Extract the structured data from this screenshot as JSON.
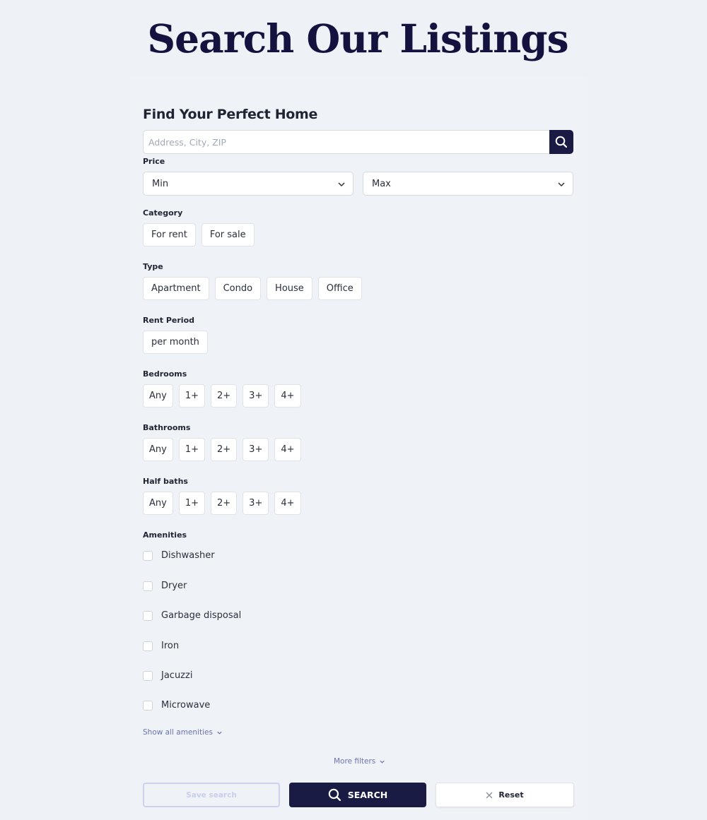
{
  "page": {
    "title": "Search Our Listings"
  },
  "form": {
    "title": "Find Your Perfect Home",
    "search": {
      "placeholder": "Address, City, ZIP",
      "value": ""
    },
    "price": {
      "label": "Price",
      "min": "Min",
      "max": "Max"
    },
    "category": {
      "label": "Category",
      "options": [
        "For rent",
        "For sale"
      ]
    },
    "type": {
      "label": "Type",
      "options": [
        "Apartment",
        "Condo",
        "House",
        "Office"
      ]
    },
    "rent_period": {
      "label": "Rent Period",
      "options": [
        "per month"
      ]
    },
    "bedrooms": {
      "label": "Bedrooms",
      "options": [
        "Any",
        "1+",
        "2+",
        "3+",
        "4+"
      ]
    },
    "bathrooms": {
      "label": "Bathrooms",
      "options": [
        "Any",
        "1+",
        "2+",
        "3+",
        "4+"
      ]
    },
    "half_baths": {
      "label": "Half baths",
      "options": [
        "Any",
        "1+",
        "2+",
        "3+",
        "4+"
      ]
    },
    "amenities": {
      "label": "Amenities",
      "items": [
        "Dishwasher",
        "Dryer",
        "Garbage disposal",
        "Iron",
        "Jacuzzi",
        "Microwave"
      ],
      "show_all": "Show all amenities"
    },
    "more_filters": "More filters",
    "buttons": {
      "save": "Save search",
      "search": "SEARCH",
      "reset": "Reset"
    }
  },
  "colors": {
    "accent": "#1a1b45",
    "title": "#14123f",
    "link": "#6b73b0",
    "background": "#eef1f5"
  },
  "icons": {
    "search": "search-icon",
    "dropdown": "chevron-down-icon",
    "reset": "close-icon"
  }
}
